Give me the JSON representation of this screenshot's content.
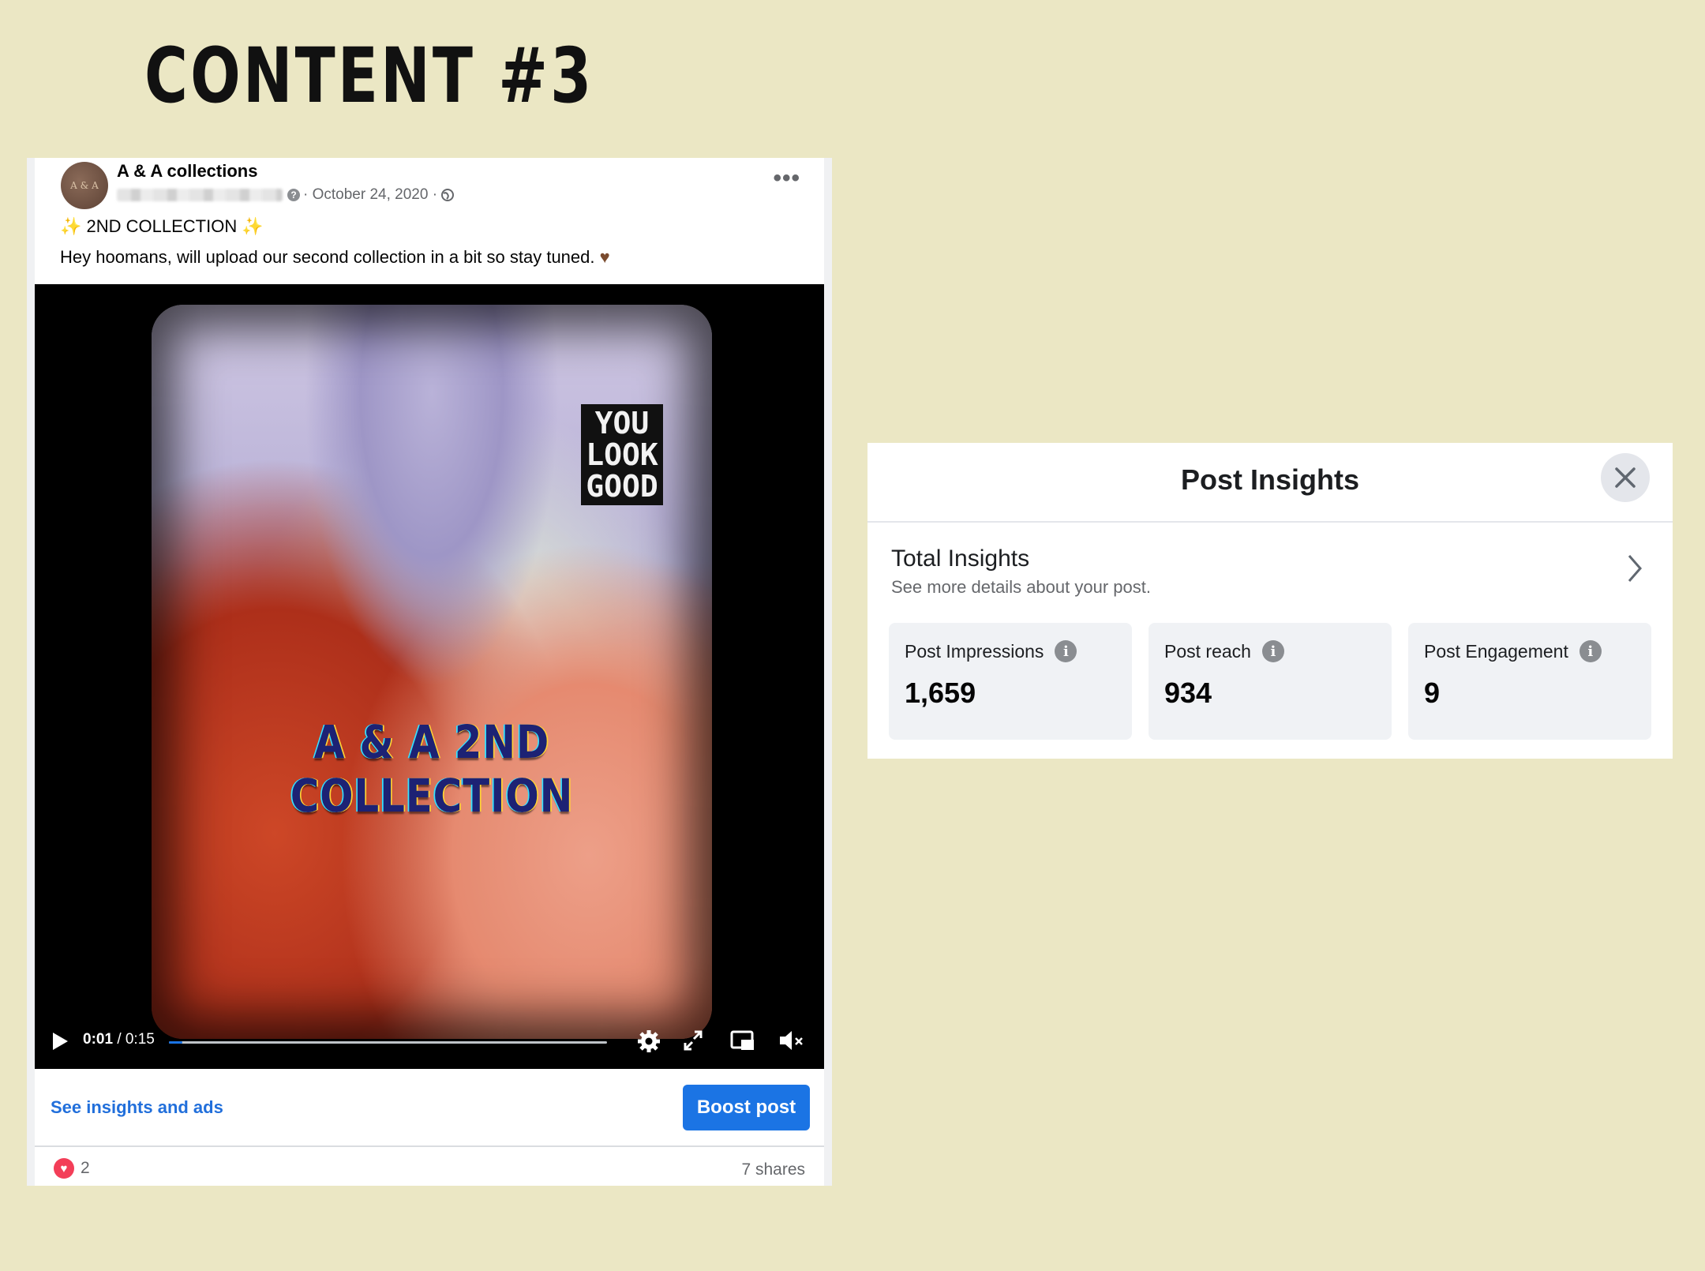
{
  "slide": {
    "title": "CONTENT #3"
  },
  "post": {
    "page_name": "A & A collections",
    "avatar_text": "A & A",
    "date": "· October 24, 2020 ·",
    "headline": "2ND COLLECTION",
    "body": "Hey hoomans, will upload our second collection in a bit so stay tuned.",
    "video": {
      "tag_text": "YOU LOOK GOOD",
      "overlay_text": "A & A 2ND COLLECTION",
      "time_current": "0:01",
      "time_total": "/ 0:15",
      "progress": 0.03
    },
    "insights_link": "See insights and ads",
    "boost_label": "Boost post",
    "reaction_count": "2",
    "shares": "7 shares"
  },
  "insights_panel": {
    "title": "Post Insights",
    "total_title": "Total Insights",
    "total_subtitle": "See more details about your post.",
    "metrics": [
      {
        "label": "Post Impressions",
        "value": "1,659"
      },
      {
        "label": "Post reach",
        "value": "934"
      },
      {
        "label": "Post Engagement",
        "value": "9"
      }
    ]
  },
  "colors": {
    "background": "#ebe7c4",
    "accent": "#1b74e4",
    "link": "#216fdb",
    "love": "#f33e58"
  }
}
